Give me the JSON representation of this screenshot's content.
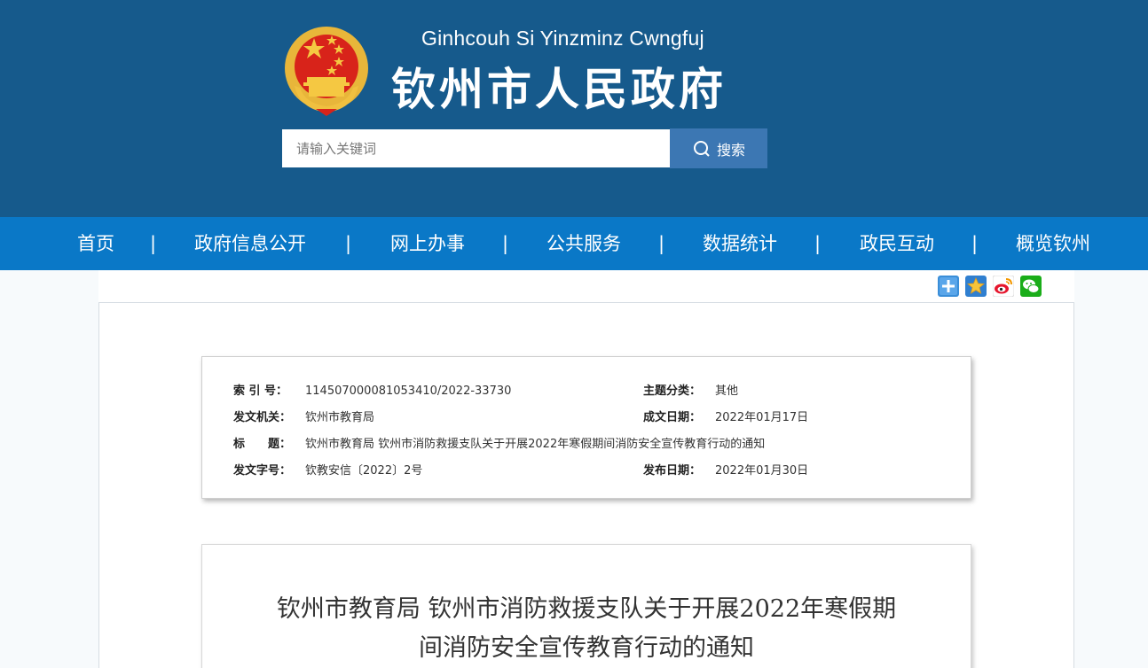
{
  "header": {
    "zhuang_name": "Ginhcouh Si Yinzminz Cwngfuj",
    "title": "钦州市人民政府",
    "background_color": "#165a8c"
  },
  "search": {
    "placeholder": "请输入关键词",
    "button_label": "搜索"
  },
  "nav": {
    "items": [
      "首页",
      "政府信息公开",
      "网上办事",
      "公共服务",
      "数据统计",
      "政民互动",
      "概览钦州"
    ],
    "separator": "|",
    "background_color": "#0a78c7"
  },
  "share": {
    "icons": [
      "share-plus-icon",
      "favorite-star-icon",
      "weibo-icon",
      "wechat-icon"
    ]
  },
  "meta": {
    "index_label": "索 引 号：",
    "index_value": "114507000081053410/2022-33730",
    "topic_label": "主题分类：",
    "topic_value": "其他",
    "issuer_label": "发文机关：",
    "issuer_value": "钦州市教育局",
    "created_label": "成文日期：",
    "created_value": "2022年01月17日",
    "title_label": "标　　题：",
    "title_value": "钦州市教育局 钦州市消防救援支队关于开展2022年寒假期间消防安全宣传教育行动的通知",
    "docno_label": "发文字号：",
    "docno_value": "钦教安信〔2022〕2号",
    "published_label": "发布日期：",
    "published_value": "2022年01月30日"
  },
  "article": {
    "title_line1": "钦州市教育局 钦州市消防救援支队关于开展2022年寒假期",
    "title_line2": "间消防安全宣传教育行动的通知"
  }
}
